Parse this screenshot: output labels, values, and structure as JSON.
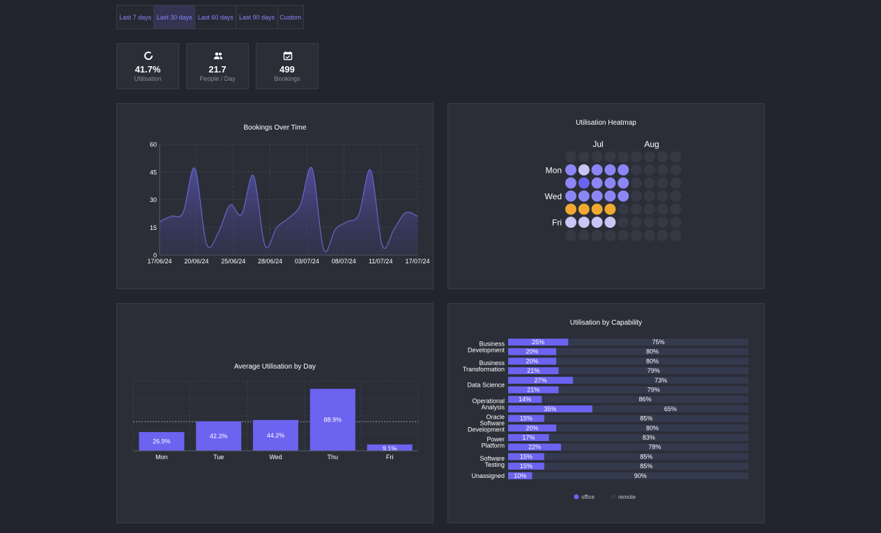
{
  "range_tabs": {
    "items": [
      "Last 7 days",
      "Last 30 days",
      "Last 60 days",
      "Last 90 days",
      "Custom"
    ],
    "active_index": 1
  },
  "stats": [
    {
      "value": "41.7%",
      "label": "Utilisation",
      "icon": "donut-icon"
    },
    {
      "value": "21.7",
      "label": "People / Day",
      "icon": "people-icon"
    },
    {
      "value": "499",
      "label": "Bookings",
      "icon": "calendar-check-icon"
    }
  ],
  "colors": {
    "accent": "#6c63f0",
    "light": "#c9c6f5",
    "highlight": "#f0a830",
    "empty": "#363944",
    "remote": "#343a4e",
    "text_accent": "#8b86ff"
  },
  "bookings_chart": {
    "title": "Bookings Over Time",
    "chart_data": {
      "type": "area",
      "x_tick_labels": [
        "17/06/24",
        "20/06/24",
        "25/06/24",
        "28/06/24",
        "03/07/24",
        "08/07/24",
        "11/07/24",
        "17/07/24"
      ],
      "y_ticks": [
        0,
        15,
        30,
        45,
        60
      ],
      "ylim": [
        0,
        60
      ],
      "grid": true,
      "series": [
        {
          "values": [
            18,
            21,
            23,
            47,
            6,
            12,
            27,
            22,
            43,
            5,
            15,
            20,
            27,
            47,
            3,
            14,
            18,
            22,
            46,
            5,
            14,
            23,
            21
          ]
        }
      ]
    }
  },
  "heatmap": {
    "title": "Utilisation Heatmap",
    "chart_data": {
      "type": "heatmap",
      "months": [
        "Jul",
        "Aug"
      ],
      "row_labels": [
        "Mon",
        "",
        "Wed",
        "",
        "Fri",
        ""
      ],
      "legend": [
        "empty",
        "accent",
        "mid",
        "light",
        "highlight"
      ],
      "cells": [
        [
          0,
          0,
          0,
          0,
          0,
          0,
          0,
          0,
          0
        ],
        [
          2,
          3,
          2,
          2,
          2,
          0,
          0,
          0,
          0
        ],
        [
          2,
          1,
          2,
          2,
          2,
          0,
          0,
          0,
          0
        ],
        [
          2,
          2,
          2,
          2,
          2,
          0,
          0,
          0,
          0
        ],
        [
          4,
          4,
          4,
          4,
          0,
          0,
          0,
          0,
          0
        ],
        [
          3,
          3,
          3,
          3,
          0,
          0,
          0,
          0,
          0
        ],
        [
          0,
          0,
          0,
          0,
          0,
          0,
          0,
          0,
          0
        ]
      ]
    }
  },
  "avg_util": {
    "title": "Average Utilisation by Day",
    "chart_data": {
      "type": "bar",
      "categories": [
        "Mon",
        "Tue",
        "Wed",
        "Thu",
        "Fri"
      ],
      "values": [
        26.9,
        42.3,
        44.2,
        88.9,
        9.1
      ],
      "labels": [
        "26.9%",
        "42.3%",
        "44.2%",
        "88.9%",
        "9.1%"
      ],
      "ylim": [
        0,
        100
      ],
      "reference_line": 41.7
    }
  },
  "capability": {
    "title": "Utilisation by Capability",
    "chart_data": {
      "type": "bar",
      "orientation": "horizontal",
      "stacked": true,
      "groups": [
        {
          "label": [
            "Business",
            "Development"
          ],
          "rows": 2
        },
        {
          "label": [
            "Business",
            "Transformation"
          ],
          "rows": 2
        },
        {
          "label": [
            "Data Science"
          ],
          "rows": 2
        },
        {
          "label": [
            "Operational",
            "Analysis"
          ],
          "rows": 2
        },
        {
          "label": [
            "Oracle",
            "Software",
            "Development"
          ],
          "rows": 2
        },
        {
          "label": [
            "Power",
            "Platform"
          ],
          "rows": 2
        },
        {
          "label": [
            "Software",
            "Testing"
          ],
          "rows": 2
        },
        {
          "label": [
            "Unassigned"
          ],
          "rows": 1
        }
      ],
      "series": [
        {
          "name": "office",
          "values": [
            25,
            20,
            20,
            21,
            27,
            21,
            14,
            35,
            15,
            20,
            17,
            22,
            15,
            15,
            10
          ]
        },
        {
          "name": "remote",
          "values": [
            75,
            80,
            80,
            79,
            73,
            79,
            86,
            65,
            85,
            80,
            83,
            78,
            85,
            85,
            90
          ]
        }
      ],
      "legend": [
        "office",
        "remote"
      ],
      "legend_position": "bottom"
    }
  }
}
